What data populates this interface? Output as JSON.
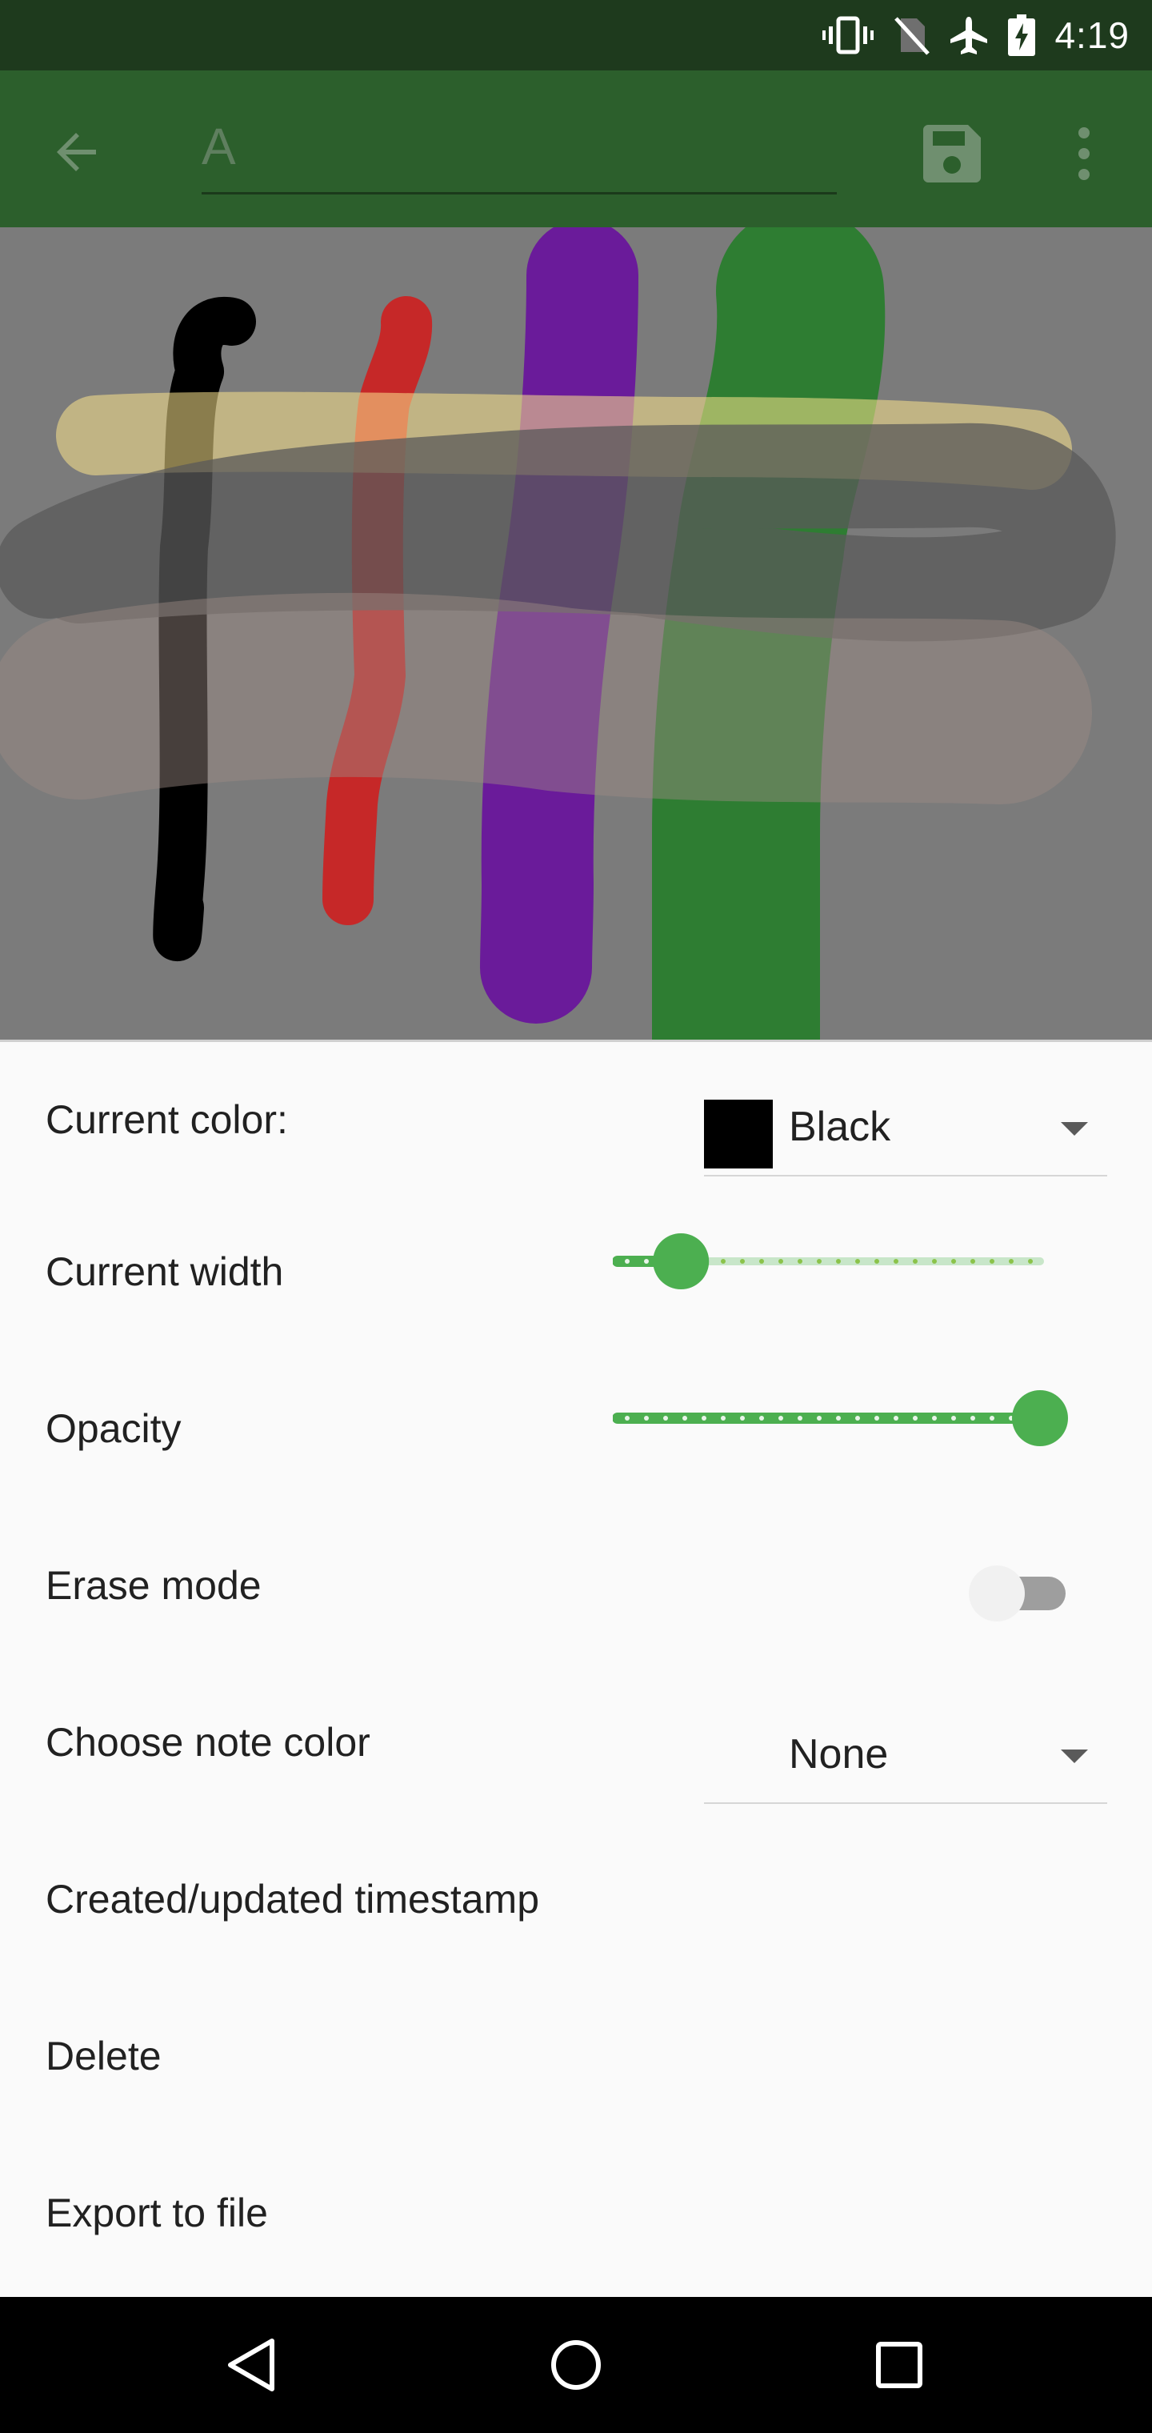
{
  "status_bar": {
    "time": "4:19",
    "icons": [
      "vibrate-icon",
      "no-sim-icon",
      "airplane-mode-icon",
      "battery-charging-icon"
    ]
  },
  "toolbar": {
    "title_value": "A",
    "icons": [
      "back-arrow-icon",
      "save-icon",
      "more-vert-icon"
    ]
  },
  "canvas": {
    "strokes": [
      {
        "color": "#000000"
      },
      {
        "color": "#c62828"
      },
      {
        "color": "#6a1b9a"
      },
      {
        "color": "#2e7d32"
      },
      {
        "color": "#fbe48c"
      },
      {
        "color": "#5a5a5a"
      },
      {
        "color": "#9e8c84"
      }
    ]
  },
  "settings": {
    "current_color": {
      "label": "Current color:",
      "value": "Black",
      "swatch": "#000000"
    },
    "current_width": {
      "label": "Current width",
      "level": 0.15
    },
    "opacity": {
      "label": "Opacity",
      "level": 1.0
    },
    "erase_mode": {
      "label": "Erase mode",
      "on": false
    },
    "note_color": {
      "label": "Choose note color",
      "value": "None"
    },
    "timestamp": {
      "label": "Created/updated timestamp"
    },
    "delete": {
      "label": "Delete"
    },
    "export": {
      "label": "Export to file"
    }
  },
  "nav_bar": {
    "icons": [
      "back-triangle-icon",
      "home-circle-icon",
      "recents-square-icon"
    ]
  },
  "colors": {
    "accent": "#4caf50",
    "toolbar": "#2c5f2c",
    "status_bar": "#1e3a1d"
  }
}
